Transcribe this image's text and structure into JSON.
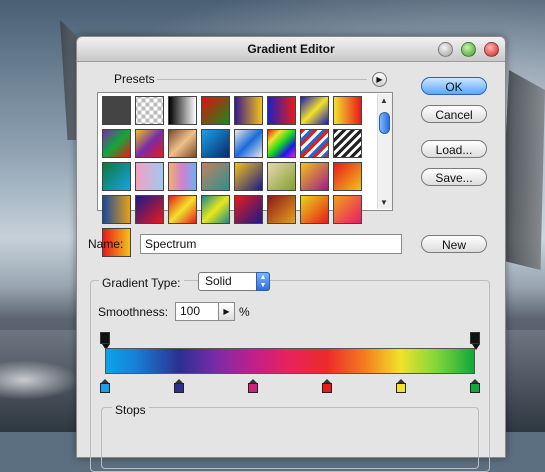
{
  "dialog": {
    "title": "Gradient Editor"
  },
  "presets": {
    "label": "Presets",
    "menu_icon": "play-triangle-icon",
    "swatches": [
      "linear-gradient(135deg,#444,#444)",
      "repeating-conic-gradient(#bbb 0% 25%, #fff 0% 50%) 50% / 8px 8px",
      "linear-gradient(90deg,#000,#fff)",
      "linear-gradient(135deg,#d11,#1a8a1a)",
      "linear-gradient(90deg,#3a1a8a,#f2c21a)",
      "linear-gradient(90deg,#2020c0,#e81a1a)",
      "linear-gradient(135deg,#1a1ac0 0%,#f2e22a 50%,#1a1ac0 100%)",
      "linear-gradient(90deg,#f2e22a,#e81a1a)",
      "linear-gradient(135deg,#7a2ca8,#11a83a,#e81a1a)",
      "linear-gradient(135deg,#f2c21a,#7a2ca8,#e81a1a)",
      "linear-gradient(135deg,#7a4a2a,#f0c08a,#7a4a2a)",
      "linear-gradient(135deg,#1aa0e8,#0a2a6a)",
      "linear-gradient(135deg,#e8e8e8,#1a6ad8,#e8e8e8)",
      "linear-gradient(135deg,#e81a1a,#f2e22a,#1ad81a,#1a1ae8,#e81ae8)",
      "repeating-linear-gradient(135deg,#e81a1a 0 3px,#fff 3px 6px,#1a6ad8 6px 9px)",
      "repeating-linear-gradient(135deg,#222 0 3px,#fff 3px 6px)",
      "linear-gradient(135deg,#0a7a3a,#1aa0e8)",
      "linear-gradient(90deg,#f5a0c0,#a0c8f0)",
      "linear-gradient(90deg,#f0b070,#d080d0,#70b0f0)",
      "linear-gradient(135deg,#c08060,#309090)",
      "linear-gradient(135deg,#f2c21a,#1a1a8a)",
      "linear-gradient(135deg,#e8d8b0,#80a030)",
      "linear-gradient(135deg,#f2c21a,#a01a8a)",
      "linear-gradient(135deg,#e81a1a,#f2c21a)",
      "linear-gradient(90deg,#1a4a9a,#e8a01a)",
      "linear-gradient(135deg,#1a1a8a,#e81a1a)",
      "linear-gradient(135deg,#e81a1a,#f2e22a,#e81a1a)",
      "linear-gradient(135deg,#1a8a8a,#e8e81a,#1a8a8a)",
      "linear-gradient(135deg,#e81a1a,#1a1a8a)",
      "linear-gradient(135deg,#8a1a1a,#e8a01a)",
      "linear-gradient(135deg,#e8d81a,#e81a1a)",
      "linear-gradient(135deg,#f2a01a,#e81a6a)",
      "linear-gradient(90deg,#e81a1a,#f2c21a)"
    ]
  },
  "buttons": {
    "ok": "OK",
    "cancel": "Cancel",
    "load": "Load...",
    "save": "Save...",
    "new": "New"
  },
  "name": {
    "label": "Name:",
    "value": "Spectrum"
  },
  "gradient": {
    "type_label": "Gradient Type:",
    "type_value": "Solid",
    "smoothness_label": "Smoothness:",
    "smoothness_value": "100",
    "smoothness_unit": "%",
    "stops_label": "Stops",
    "color_stops": [
      {
        "color": "#1aa0e8",
        "position": 0
      },
      {
        "color": "#2c2f8f",
        "position": 20
      },
      {
        "color": "#d01f80",
        "position": 40
      },
      {
        "color": "#e81a1a",
        "position": 60
      },
      {
        "color": "#f2e22a",
        "position": 80
      },
      {
        "color": "#11a83a",
        "position": 100
      }
    ],
    "opacity_stops": [
      0,
      100
    ]
  }
}
